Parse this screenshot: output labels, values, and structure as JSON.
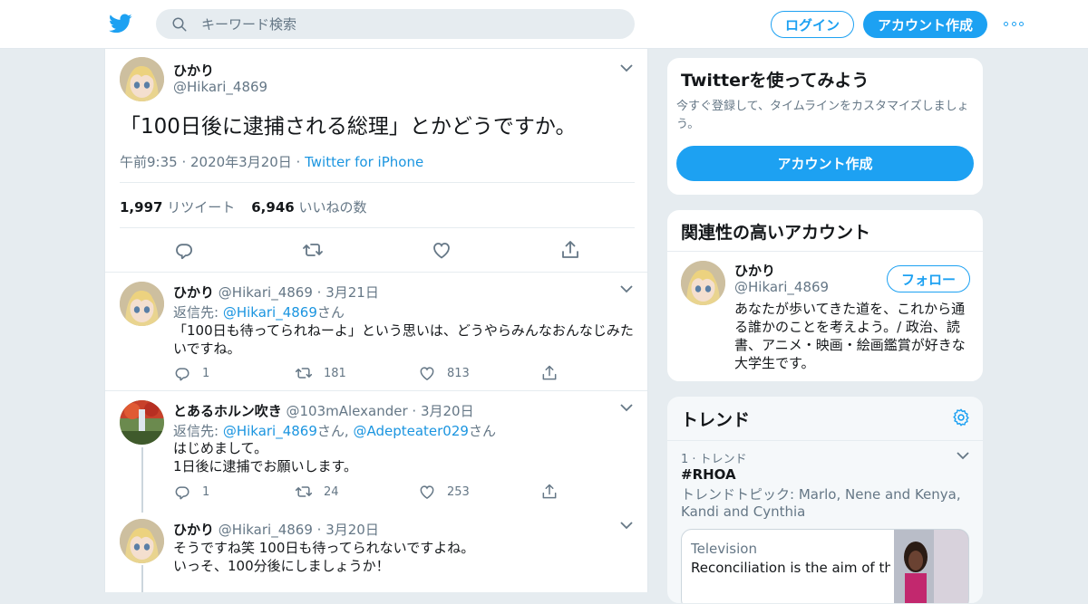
{
  "header": {
    "search_placeholder": "キーワード検索",
    "login_label": "ログイン",
    "signup_label": "アカウント作成"
  },
  "main_tweet": {
    "name": "ひかり",
    "handle": "@Hikari_4869",
    "text": "「100日後に逮捕される総理」とかどうですか。",
    "time": "午前9:35 · 2020年3月20日 · ",
    "source": "Twitter for iPhone",
    "retweet_count": "1,997",
    "retweet_label": "リツイート",
    "like_count": "6,946",
    "like_label": "いいねの数"
  },
  "replies": [
    {
      "name": "ひかり",
      "handle": "@Hikari_4869",
      "date": "· 3月21日",
      "reply_prefix": "返信先: ",
      "reply_to": "@Hikari_4869",
      "reply_suffix": "さん",
      "body": "「100日も待ってられねーよ」という思いは、どうやらみんなおんなじみたいですね。",
      "replies": "1",
      "retweets": "181",
      "likes": "813"
    },
    {
      "name": "とあるホルン吹き",
      "handle": "@103mAlexander",
      "date": "· 3月20日",
      "reply_prefix": "返信先: ",
      "reply_to": "@Hikari_4869",
      "reply_mid": "さん, ",
      "reply_to2": "@Adepteater029",
      "reply_suffix": "さん",
      "body_line1": "はじめまして。",
      "body_line2": "1日後に逮捕でお願いします。",
      "replies": "1",
      "retweets": "24",
      "likes": "253"
    },
    {
      "name": "ひかり",
      "handle": "@Hikari_4869",
      "date": "· 3月20日",
      "body_line1": "そうですね笑 100日も待ってられないですよね。",
      "body_line2": "いっそ、100分後にしましょうか！"
    }
  ],
  "sidebar": {
    "signup_card": {
      "title": "Twitterを使ってみよう",
      "desc": "今すぐ登録して、タイムラインをカスタマイズしましょう。",
      "button": "アカウント作成"
    },
    "related_card": {
      "title": "関連性の高いアカウント",
      "name": "ひかり",
      "handle": "@Hikari_4869",
      "follow": "フォロー",
      "bio": "あなたが歩いてきた道を、これから通る誰かのことを考えよう。/ 政治、読書、アニメ・映画・絵画鑑賞が好きな大学生です。"
    },
    "trends_card": {
      "title": "トレンド",
      "rank": "1 · トレンド",
      "tag": "#RHOA",
      "topic": "トレンドトピック: Marlo, Nene and Kenya, Kandi and Cynthia",
      "news_category": "Television",
      "news_headline": "Reconciliation is the aim of the"
    }
  },
  "colors": {
    "accent": "#1da1f2",
    "link": "#1b95e0",
    "muted": "#657786"
  },
  "icons": [
    "twitter-bird-icon",
    "search-icon",
    "more-icon",
    "chevron-down-icon",
    "reply-icon",
    "retweet-icon",
    "heart-icon",
    "share-icon",
    "gear-icon"
  ]
}
